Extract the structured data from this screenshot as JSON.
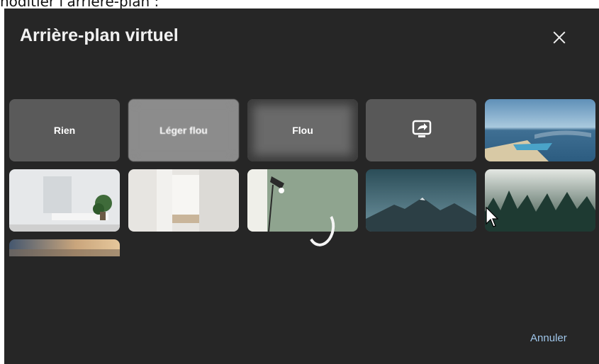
{
  "page_caption": "hoditier l'arrière-plan :",
  "dialog": {
    "title": "Arrière-plan virtuel",
    "close_icon": "close-icon",
    "cancel_label": "Annuler"
  },
  "options": {
    "none_label": "Rien",
    "light_blur_label": "Léger flou",
    "blur_label": "Flou",
    "share_icon": "share-screen-icon"
  },
  "backgrounds": [
    {
      "name": "beach-boat"
    },
    {
      "name": "room-plant"
    },
    {
      "name": "white-hallway"
    },
    {
      "name": "lamp-green-wall"
    },
    {
      "name": "mountains"
    },
    {
      "name": "misty-forest"
    },
    {
      "name": "sunset-sky"
    }
  ],
  "colors": {
    "dialog_bg": "#262626",
    "accent": "#9fc6ea"
  }
}
